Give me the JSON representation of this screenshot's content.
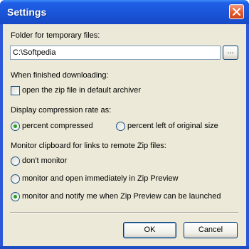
{
  "window": {
    "title": "Settings"
  },
  "folder": {
    "label": "Folder for temporary files:",
    "value": "C:\\Softpedia",
    "browse_label": "..."
  },
  "finished": {
    "label": "When finished downloading:",
    "checkbox_label": "open the zip file in default archiver",
    "checked": false
  },
  "compression": {
    "label": "Display compression rate as:",
    "options": [
      {
        "label": "percent compressed",
        "selected": true
      },
      {
        "label": "percent left of original size",
        "selected": false
      }
    ]
  },
  "clipboard": {
    "label": "Monitor clipboard for links to remote Zip files:",
    "options": [
      {
        "label": "don't monitor",
        "selected": false
      },
      {
        "label": "monitor and open immediately in Zip Preview",
        "selected": false
      },
      {
        "label": "monitor and notify me when Zip Preview can be launched",
        "selected": true
      }
    ]
  },
  "buttons": {
    "ok_label": "OK",
    "cancel_label": "Cancel"
  },
  "colors": {
    "titlebar": "#1f5fe6",
    "client": "#ece9d8",
    "close_button": "#e35a2f",
    "radio_dot": "#21a121"
  }
}
